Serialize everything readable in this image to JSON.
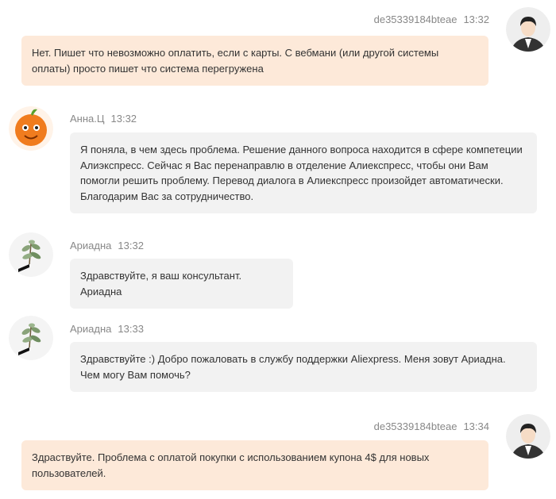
{
  "messages": [
    {
      "sender": "de35339184bteae",
      "time": "13:32",
      "text": "Нет. Пишет что невозможно оплатить, если с карты. С вебмани (или другой системы оплаты) просто пишет что система перегружена",
      "avatar_icon": "man-user-avatar"
    },
    {
      "sender": "Анна.Ц",
      "time": "13:32",
      "text": "Я поняла, в чем здесь проблема. Решение данного вопроса находится в сфере компетеции Алиэкспресс. Сейчас я Вас перенаправлю в отделение Алиекспресс, чтобы они Вам помогли решить проблему. Перевод диалога в Алиекспресс произойдет автоматически. Благодарим Вас за сотрудничество.",
      "avatar_icon": "orange-mascot-avatar"
    },
    {
      "sender": "Ариадна",
      "time": "13:32",
      "text": "Здравствуйте, я ваш консультант. Ариадна",
      "avatar_icon": "plant-avatar"
    },
    {
      "sender": "Ариадна",
      "time": "13:33",
      "text": "Здравствуйте :) Добро пожаловать в службу поддержки Aliexpress. Меня зовут Ариадна. Чем могу Вам помочь?",
      "avatar_icon": "plant-avatar"
    },
    {
      "sender": "de35339184bteae",
      "time": "13:34",
      "text": "Здраствуйте. Проблема с оплатой покупки с использованием купона 4$ для новых пользователей.",
      "avatar_icon": "man-user-avatar"
    }
  ],
  "colors": {
    "outgoing_bubble": "#fde9d9",
    "incoming_bubble": "#f2f2f2",
    "meta_text": "#888888"
  }
}
